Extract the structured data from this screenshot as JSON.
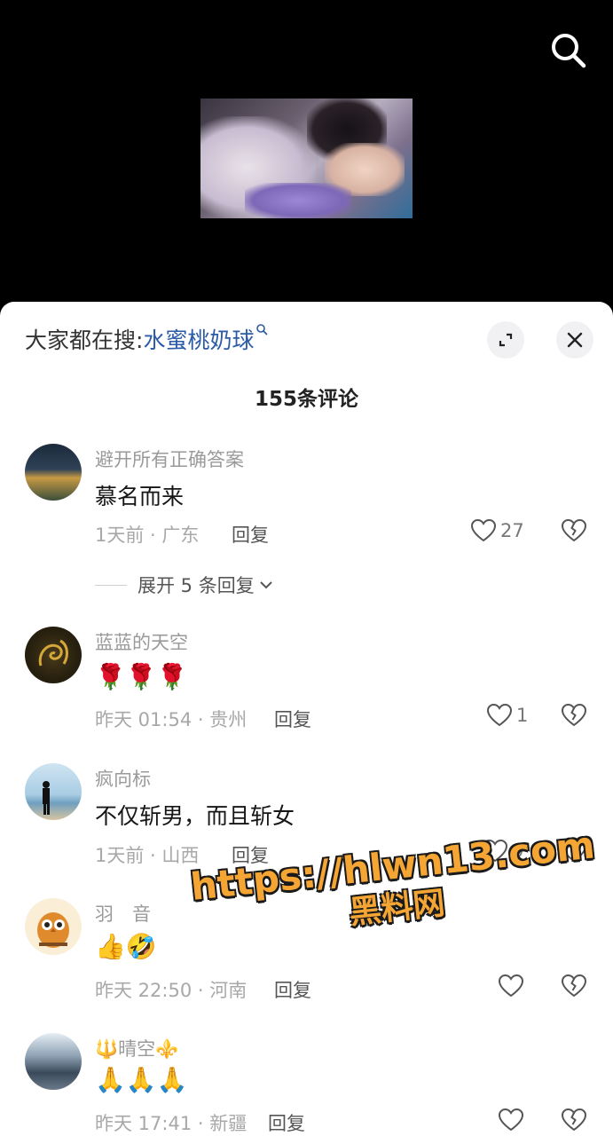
{
  "header": {
    "search_hint_prefix": "大家都在搜:",
    "search_hint_term": "水蜜桃奶球"
  },
  "comments_header": {
    "count_label": "155条评论"
  },
  "comments": [
    {
      "username": "避开所有正确答案",
      "content": "慕名而来",
      "meta": "1天前 · 广东",
      "reply_label": "回复",
      "likes": "27",
      "expand_label": "展开 5 条回复"
    },
    {
      "username": "蓝蓝的天空",
      "content": "🌹🌹🌹",
      "meta": "昨天 01:54 · 贵州",
      "reply_label": "回复",
      "likes": "1"
    },
    {
      "username": "疯向标",
      "content": "不仅斩男，而且斩女",
      "meta": "1天前 · 山西",
      "reply_label": "回复",
      "likes": "9"
    },
    {
      "username": "羽　音",
      "content": "👍🤣",
      "meta": "昨天 22:50 · 河南",
      "reply_label": "回复",
      "likes": ""
    },
    {
      "username": "🔱晴空⚜️",
      "content": "🙏🙏🙏",
      "meta": "昨天 17:41 · 新疆",
      "reply_label": "回复",
      "likes": ""
    }
  ],
  "watermark": {
    "url": "https://hlwn13.com",
    "name": "黑料网"
  },
  "colors": {
    "accent_link": "#2b5aa6",
    "watermark": "#f4a533"
  },
  "icons": [
    "search-icon",
    "expand-icon",
    "close-icon",
    "heart-icon",
    "broken-heart-icon",
    "chevron-down-icon"
  ]
}
